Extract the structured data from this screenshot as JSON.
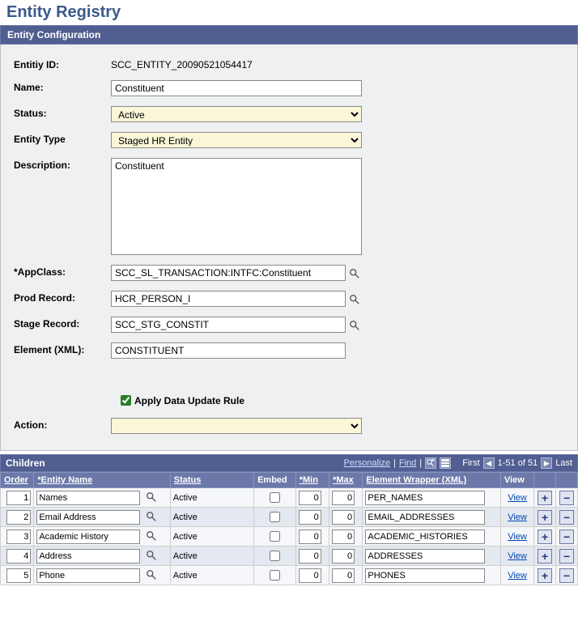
{
  "page_title": "Entity Registry",
  "config": {
    "section_title": "Entity Configuration",
    "labels": {
      "entity_id": "Entitiy ID:",
      "name": "Name:",
      "status": "Status:",
      "entity_type": "Entity Type",
      "description": "Description:",
      "app_class": "*AppClass:",
      "prod_record": "Prod Record:",
      "stage_record": "Stage Record:",
      "element_xml": "Element (XML):",
      "apply_rule": "Apply Data Update Rule",
      "action": "Action:"
    },
    "values": {
      "entity_id": "SCC_ENTITY_20090521054417",
      "name": "Constituent",
      "status": "Active",
      "entity_type": "Staged HR Entity",
      "description": "Constituent",
      "app_class": "SCC_SL_TRANSACTION:INTFC:Constituent",
      "prod_record": "HCR_PERSON_I",
      "stage_record": "SCC_STG_CONSTIT",
      "element_xml": "CONSTITUENT",
      "apply_rule_checked": true,
      "action": ""
    }
  },
  "children": {
    "title": "Children",
    "toolbar": {
      "personalize": "Personalize",
      "find": "Find",
      "first": "First",
      "range": "1-51 of 51",
      "last": "Last"
    },
    "headers": {
      "order": "Order",
      "entity_name": "*Entity Name",
      "status": "Status",
      "embed": "Embed",
      "min": "*Min",
      "max": "*Max",
      "wrapper": "Element Wrapper (XML)",
      "view": "View"
    },
    "view_label": "View",
    "rows": [
      {
        "order": "1",
        "entity": "Names",
        "status": "Active",
        "embed": false,
        "min": "0",
        "max": "0",
        "wrapper": "PER_NAMES"
      },
      {
        "order": "2",
        "entity": "Email Address",
        "status": "Active",
        "embed": false,
        "min": "0",
        "max": "0",
        "wrapper": "EMAIL_ADDRESSES"
      },
      {
        "order": "3",
        "entity": "Academic History",
        "status": "Active",
        "embed": false,
        "min": "0",
        "max": "0",
        "wrapper": "ACADEMIC_HISTORIES"
      },
      {
        "order": "4",
        "entity": "Address",
        "status": "Active",
        "embed": false,
        "min": "0",
        "max": "0",
        "wrapper": "ADDRESSES"
      },
      {
        "order": "5",
        "entity": "Phone",
        "status": "Active",
        "embed": false,
        "min": "0",
        "max": "0",
        "wrapper": "PHONES"
      }
    ]
  }
}
